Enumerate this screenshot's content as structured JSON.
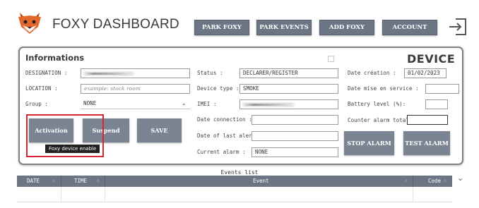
{
  "header": {
    "title": "FOXY DASHBOARD",
    "nav": [
      "PARK FOXY",
      "PARK EVENTS",
      "ADD FOXY",
      "ACCOUNT"
    ]
  },
  "informations": {
    "heading": "Informations",
    "designation_label": "DESIGNATION :",
    "location_label": "LOCATION :",
    "location_placeholder": "example: stock room",
    "group_label": "Group :",
    "group_value": "NONE"
  },
  "actions": {
    "activation": "Activation",
    "suspend": "Suspend",
    "save": "SAVE",
    "tooltip": "Foxy device enable"
  },
  "status": {
    "status_label": "Status :",
    "status_value": "DECLARER/REGISTER",
    "type_label": "Device type :",
    "type_value": "SMOKE",
    "imei_label": "IMEI :",
    "date_connection_label": "Date connection :",
    "date_last_alert_label": "Date of last alert :",
    "current_alarm_label": "Current alarm :",
    "current_alarm_value": "NONE"
  },
  "device": {
    "heading": "DEVICE",
    "creation_label": "Date création :",
    "creation_value": "01/02/2023",
    "service_label": "Date mise en service :",
    "battery_label": "Battery level (%):",
    "counter_label": "Counter alarm total :",
    "stop_alarm": "STOP ALARM",
    "test_alarm": "TEST ALARM"
  },
  "events": {
    "title": "Events list",
    "columns": [
      "DATE",
      "TIME",
      "Event",
      "Code"
    ]
  },
  "colors": {
    "button": "#6c7584",
    "highlight": "#d9262f",
    "fox_orange": "#e2672a"
  }
}
